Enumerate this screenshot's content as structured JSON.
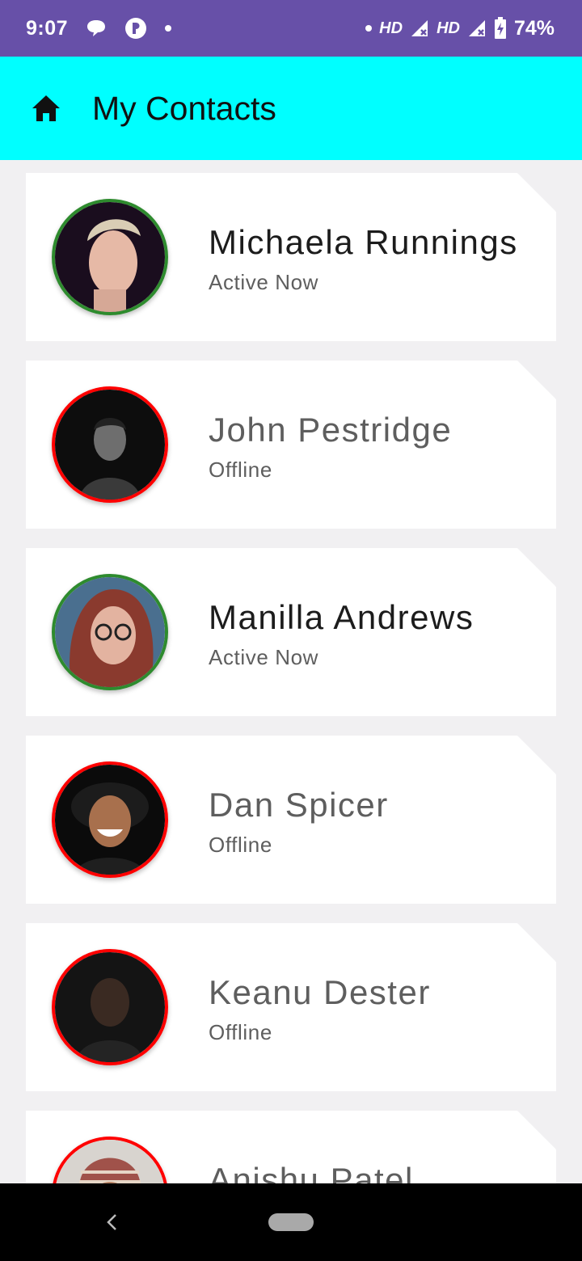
{
  "status_bar": {
    "time": "9:07",
    "network_1": "HD",
    "network_2": "HD",
    "battery": "74%"
  },
  "app_bar": {
    "title": "My Contacts",
    "icon": "home-icon"
  },
  "colors": {
    "status_bar": "#6750a8",
    "app_bar": "#00ffff",
    "online_ring": "#2e8b2e",
    "offline_ring": "#ff0000",
    "online_name": "#1c1c1c",
    "offline_name": "#5e5e5e"
  },
  "contacts": [
    {
      "name": "Michaela Runnings",
      "status": "Active Now",
      "online": true
    },
    {
      "name": "John Pestridge",
      "status": "Offline",
      "online": false
    },
    {
      "name": "Manilla Andrews",
      "status": "Active Now",
      "online": true
    },
    {
      "name": "Dan Spicer",
      "status": "Offline",
      "online": false
    },
    {
      "name": "Keanu Dester",
      "status": "Offline",
      "online": false
    },
    {
      "name": "Anishu Patel",
      "status": "",
      "online": false
    }
  ],
  "nav_bar": {
    "back": "back-icon",
    "home": "home-pill"
  }
}
